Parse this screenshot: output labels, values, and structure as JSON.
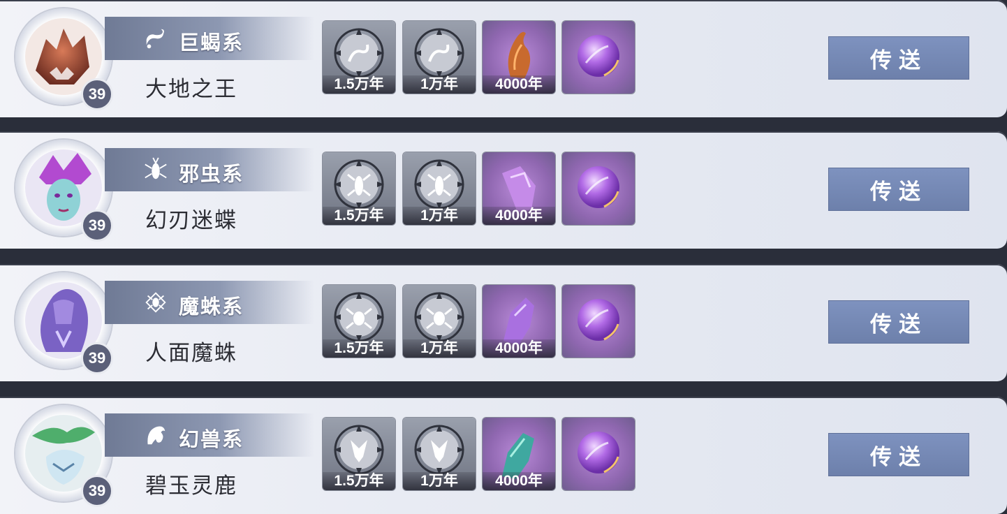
{
  "rows": [
    {
      "type_icon": "scorpion-icon",
      "type_label": "巨蝎系",
      "name": "大地之王",
      "level": "39",
      "items": [
        {
          "icon": "scorpion-bone-icon",
          "caption": "1.5万年"
        },
        {
          "icon": "scorpion-bone-icon",
          "caption": "1万年"
        },
        {
          "icon": "claw-bone-icon",
          "caption": "4000年"
        },
        {
          "icon": "purple-orb-icon",
          "caption": ""
        }
      ],
      "button": "传送"
    },
    {
      "type_icon": "bug-icon",
      "type_label": "邪虫系",
      "name": "幻刃迷蝶",
      "level": "39",
      "items": [
        {
          "icon": "bug-bone-icon",
          "caption": "1.5万年"
        },
        {
          "icon": "bug-bone-icon",
          "caption": "1万年"
        },
        {
          "icon": "arm-bone-icon",
          "caption": "4000年"
        },
        {
          "icon": "purple-orb-icon",
          "caption": ""
        }
      ],
      "button": "传送"
    },
    {
      "type_icon": "spider-icon",
      "type_label": "魔蛛系",
      "name": "人面魔蛛",
      "level": "39",
      "items": [
        {
          "icon": "spider-bone-icon",
          "caption": "1.5万年"
        },
        {
          "icon": "spider-bone-icon",
          "caption": "1万年"
        },
        {
          "icon": "arm-bone-icon",
          "caption": "4000年"
        },
        {
          "icon": "purple-orb-icon",
          "caption": ""
        }
      ],
      "button": "传送"
    },
    {
      "type_icon": "beast-icon",
      "type_label": "幻兽系",
      "name": "碧玉灵鹿",
      "level": "39",
      "items": [
        {
          "icon": "beast-bone-icon",
          "caption": "1.5万年"
        },
        {
          "icon": "beast-bone-icon",
          "caption": "1万年"
        },
        {
          "icon": "jade-arm-bone-icon",
          "caption": "4000年"
        },
        {
          "icon": "purple-orb-icon",
          "caption": ""
        }
      ],
      "button": "传送"
    }
  ],
  "colors": {
    "row_bg": "#e8ebf3",
    "type_bar": "#7f8aa5",
    "button": "#7588b5",
    "level_badge": "#5b6079"
  }
}
